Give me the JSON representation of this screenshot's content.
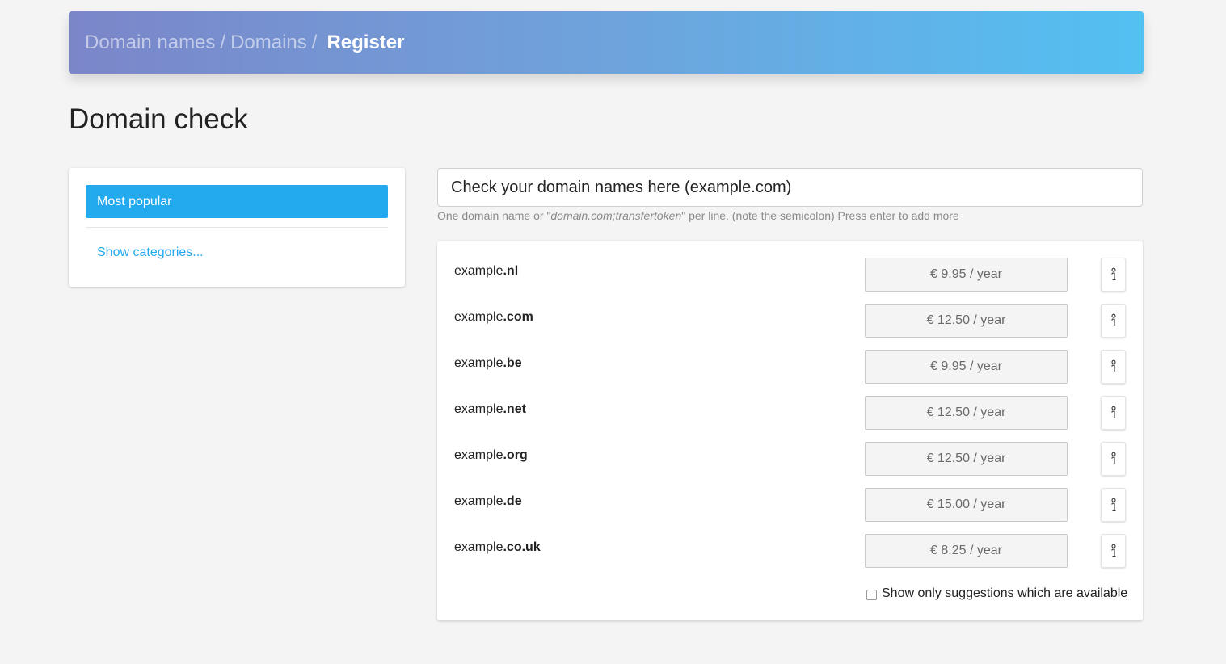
{
  "breadcrumb": {
    "items": [
      "Domain names",
      "Domains"
    ],
    "separator": "/",
    "current": "Register"
  },
  "page": {
    "title": "Domain check"
  },
  "sidebar": {
    "active_label": "Most popular",
    "link_label": "Show categories..."
  },
  "search": {
    "placeholder": "Check your domain names here (example.com)",
    "help_prefix": "One domain name or \"",
    "help_example": "domain.com;transfertoken",
    "help_suffix": "\" per line. (note the semicolon) Press enter to add more"
  },
  "results": [
    {
      "name": "example",
      "tld": ".nl",
      "price": "€ 9.95 / year"
    },
    {
      "name": "example",
      "tld": ".com",
      "price": "€ 12.50 / year"
    },
    {
      "name": "example",
      "tld": ".be",
      "price": "€ 9.95 / year"
    },
    {
      "name": "example",
      "tld": ".net",
      "price": "€ 12.50 / year"
    },
    {
      "name": "example",
      "tld": ".org",
      "price": "€ 12.50 / year"
    },
    {
      "name": "example",
      "tld": ".de",
      "price": "€ 15.00 / year"
    },
    {
      "name": "example",
      "tld": ".co.uk",
      "price": "€ 8.25 / year"
    }
  ],
  "filter": {
    "label": "Show only suggestions which are available",
    "checked": false
  },
  "colors": {
    "accent": "#23a9ee",
    "header_gradient_start": "#7b86c9",
    "header_gradient_end": "#53c0f2"
  },
  "icons": {
    "info_button": "info-icon"
  }
}
